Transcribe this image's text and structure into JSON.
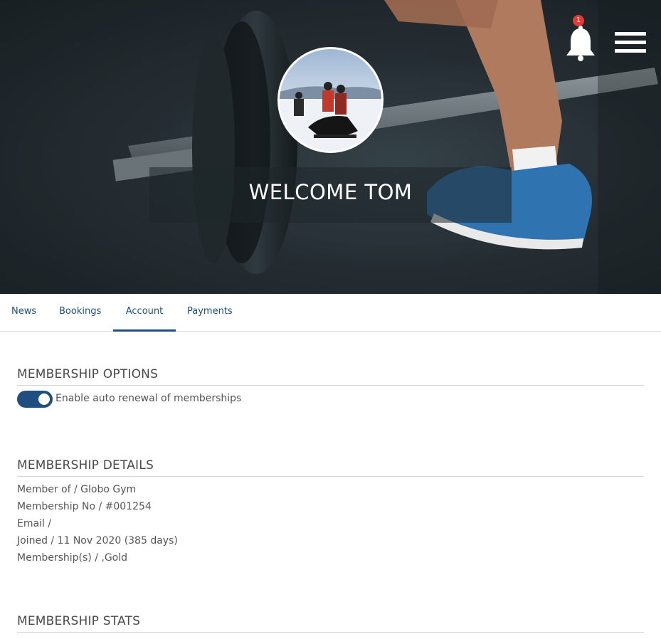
{
  "header": {
    "welcome": "WELCOME TOM",
    "notification_count": "1"
  },
  "tabs": [
    {
      "label": "News",
      "active": false
    },
    {
      "label": "Bookings",
      "active": false
    },
    {
      "label": "Account",
      "active": true
    },
    {
      "label": "Payments",
      "active": false
    }
  ],
  "membership_options": {
    "title": "MEMBERSHIP OPTIONS",
    "auto_renew_label": "Enable auto renewal of memberships",
    "auto_renew_enabled": true
  },
  "membership_details": {
    "title": "MEMBERSHIP DETAILS",
    "rows": [
      "Member of / Globo Gym",
      "Membership No / #001254",
      "Email /",
      "Joined / 11 Nov 2020 (385 days)",
      "Membership(s) / ,Gold"
    ]
  },
  "membership_stats": {
    "title": "MEMBERSHIP STATS"
  },
  "colors": {
    "accent": "#1e4f80",
    "badge": "#e53935"
  }
}
